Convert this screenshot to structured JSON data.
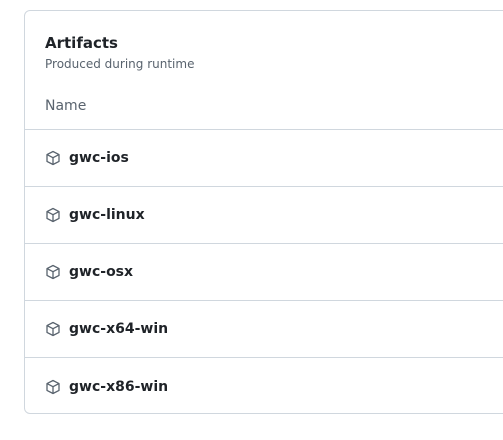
{
  "artifacts": {
    "title": "Artifacts",
    "subtitle": "Produced during runtime",
    "column_name": "Name",
    "items": [
      {
        "name": "gwc-ios",
        "icon": "package-icon"
      },
      {
        "name": "gwc-linux",
        "icon": "package-icon"
      },
      {
        "name": "gwc-osx",
        "icon": "package-icon"
      },
      {
        "name": "gwc-x64-win",
        "icon": "package-icon"
      },
      {
        "name": "gwc-x86-win",
        "icon": "package-icon"
      }
    ]
  }
}
